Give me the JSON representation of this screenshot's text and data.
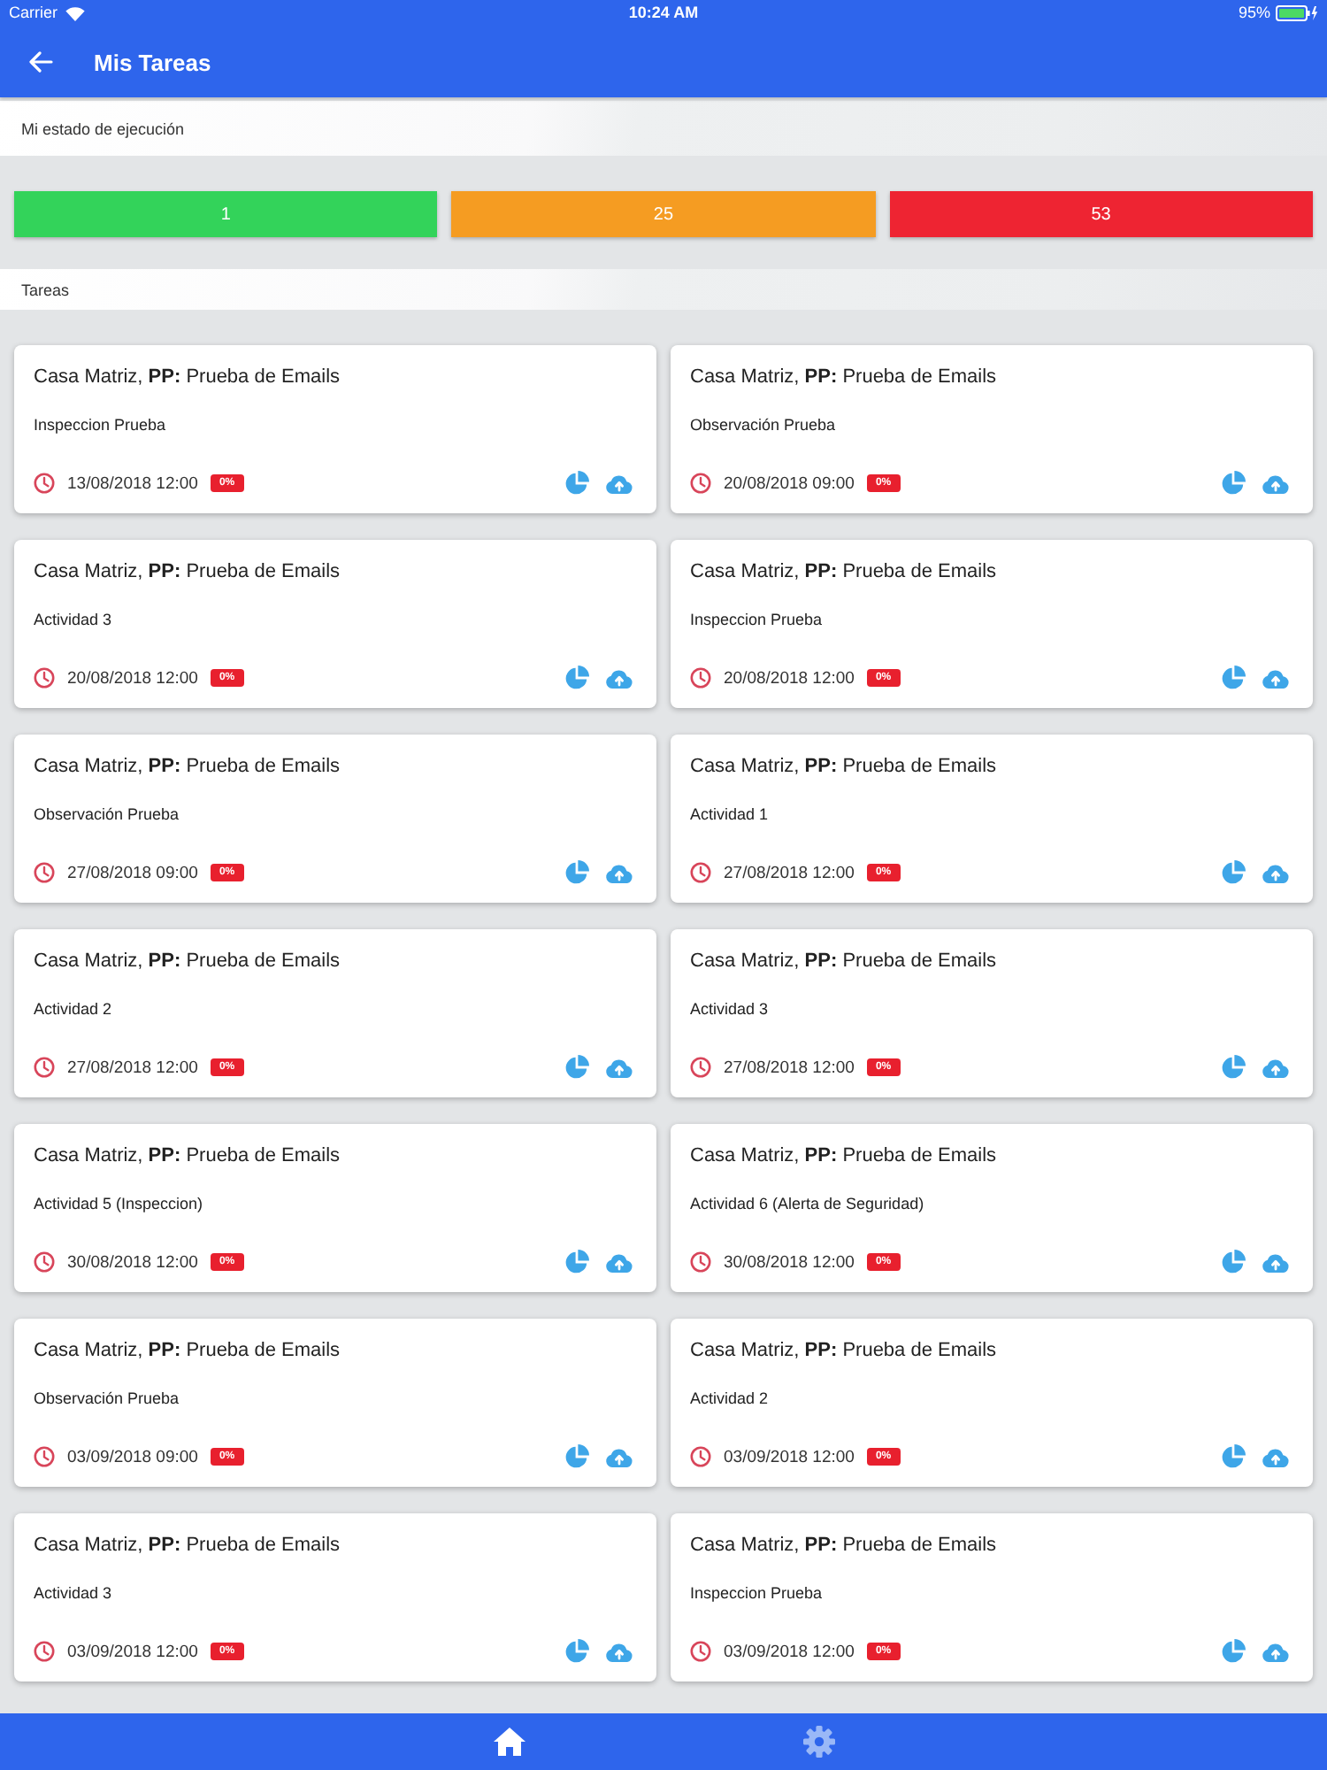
{
  "status_bar": {
    "carrier": "Carrier",
    "time": "10:24 AM",
    "battery": "95%"
  },
  "header": {
    "title": "Mis Tareas"
  },
  "execution_status": {
    "title": "Mi estado de ejecución",
    "counts": [
      {
        "value": "1",
        "color": "#33d35a"
      },
      {
        "value": "25",
        "color": "#f59c22"
      },
      {
        "value": "53",
        "color": "#ee2432"
      }
    ]
  },
  "tasks": {
    "title": "Tareas",
    "cards": [
      {
        "title": "Casa Matriz, **PP:** Prueba de Emails",
        "activity": "Inspeccion Prueba",
        "due": "13/08/2018 12:00",
        "progress": "0%"
      },
      {
        "title": "Casa Matriz, **PP:** Prueba de Emails",
        "activity": "Observación Prueba",
        "due": "20/08/2018 09:00",
        "progress": "0%"
      },
      {
        "title": "Casa Matriz, **PP:** Prueba de Emails",
        "activity": "Actividad 3",
        "due": "20/08/2018 12:00",
        "progress": "0%"
      },
      {
        "title": "Casa Matriz, **PP:** Prueba de Emails",
        "activity": "Inspeccion Prueba",
        "due": "20/08/2018 12:00",
        "progress": "0%"
      },
      {
        "title": "Casa Matriz, **PP:** Prueba de Emails",
        "activity": "Observación Prueba",
        "due": "27/08/2018 09:00",
        "progress": "0%"
      },
      {
        "title": "Casa Matriz, **PP:** Prueba de Emails",
        "activity": "Actividad 1",
        "due": "27/08/2018 12:00",
        "progress": "0%"
      },
      {
        "title": "Casa Matriz, **PP:** Prueba de Emails",
        "activity": "Actividad 2",
        "due": "27/08/2018 12:00",
        "progress": "0%"
      },
      {
        "title": "Casa Matriz, **PP:** Prueba de Emails",
        "activity": "Actividad 3",
        "due": "27/08/2018 12:00",
        "progress": "0%"
      },
      {
        "title": "Casa Matriz, **PP:** Prueba de Emails",
        "activity": "Actividad 5 (Inspeccion)",
        "due": "30/08/2018 12:00",
        "progress": "0%"
      },
      {
        "title": "Casa Matriz, **PP:** Prueba de Emails",
        "activity": "Actividad 6 (Alerta de Seguridad)",
        "due": "30/08/2018 12:00",
        "progress": "0%"
      },
      {
        "title": "Casa Matriz, **PP:** Prueba de Emails",
        "activity": "Observación Prueba",
        "due": "03/09/2018 09:00",
        "progress": "0%"
      },
      {
        "title": "Casa Matriz, **PP:** Prueba de Emails",
        "activity": "Actividad 2",
        "due": "03/09/2018 12:00",
        "progress": "0%"
      },
      {
        "title": "Casa Matriz, **PP:** Prueba de Emails",
        "activity": "Actividad 3",
        "due": "03/09/2018 12:00",
        "progress": "0%"
      },
      {
        "title": "Casa Matriz, **PP:** Prueba de Emails",
        "activity": "Inspeccion Prueba",
        "due": "03/09/2018 12:00",
        "progress": "0%"
      }
    ]
  },
  "bottom_nav": [
    {
      "selected": true
    },
    {
      "selected": false
    }
  ]
}
